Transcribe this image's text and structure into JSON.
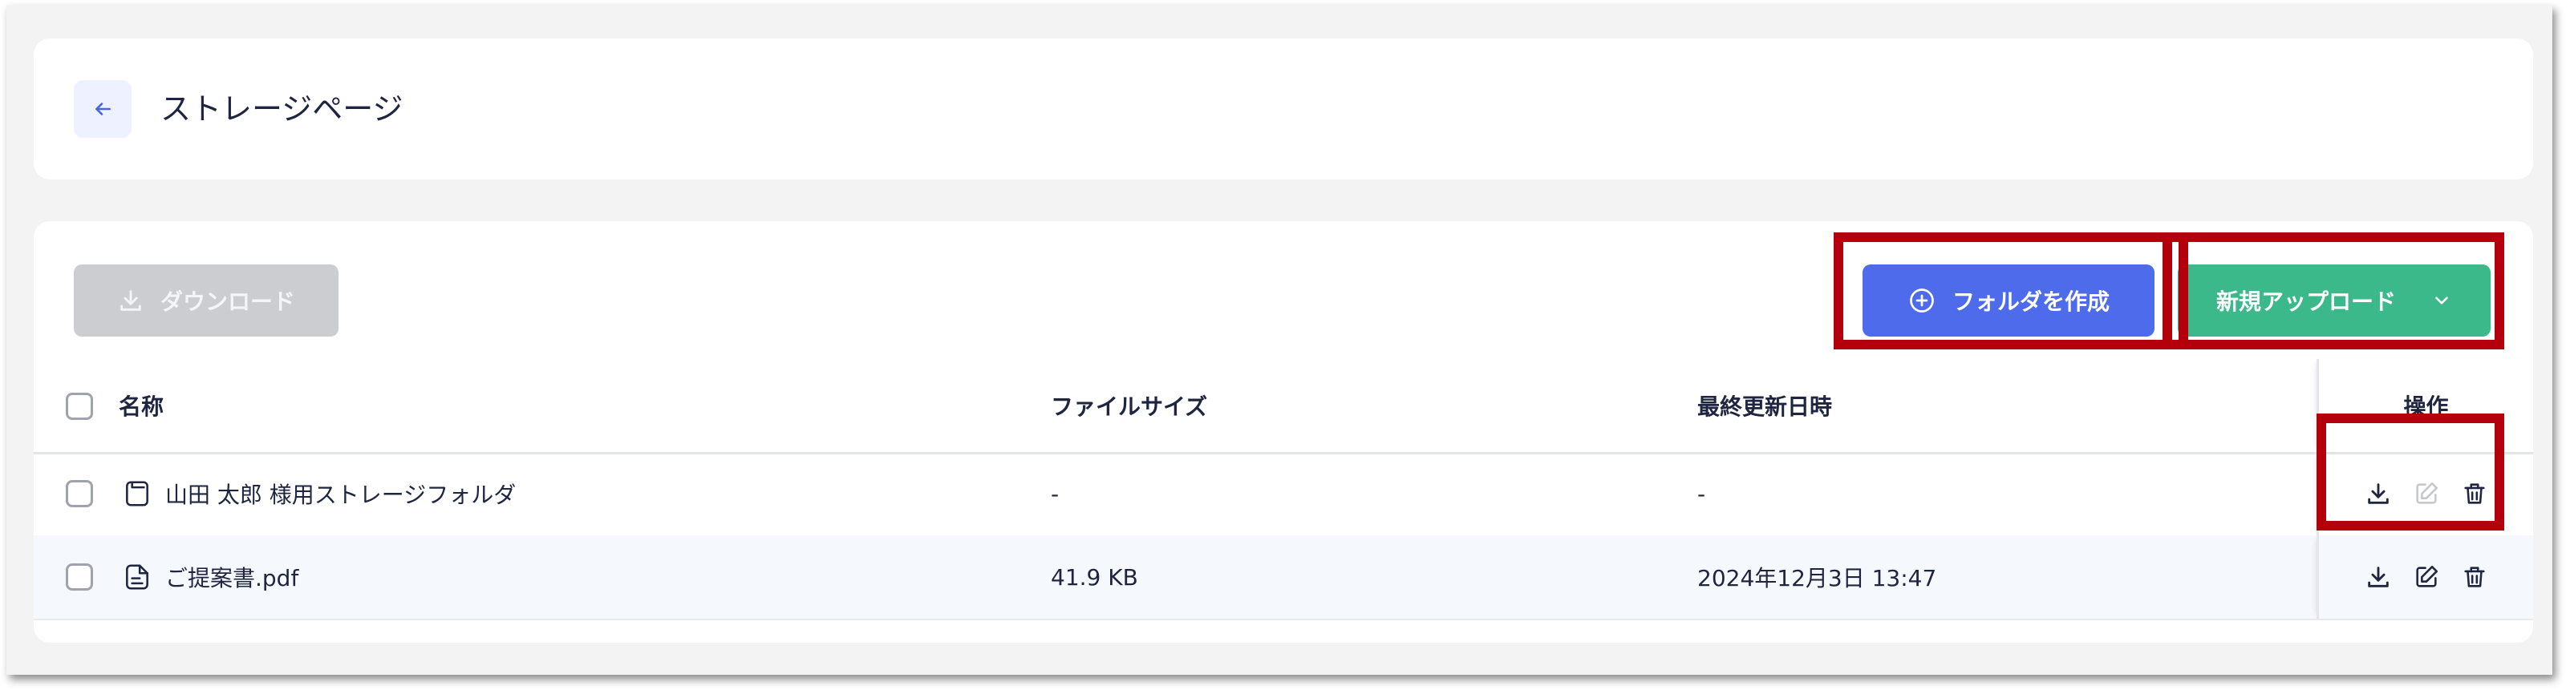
{
  "header": {
    "title": "ストレージページ",
    "back_icon": "arrow-left-icon"
  },
  "toolbar": {
    "download_label": "ダウンロード",
    "create_folder_label": "フォルダを作成",
    "upload_label": "新規アップロード"
  },
  "table": {
    "columns": {
      "name": "名称",
      "size": "ファイルサイズ",
      "updated": "最終更新日時",
      "actions": "操作"
    },
    "rows": [
      {
        "name": "山田 太郎 様用ストレージフォルダ",
        "size": "-",
        "updated": "-",
        "type": "folder"
      },
      {
        "name": "ご提案書.pdf",
        "size": "41.9 KB",
        "updated": "2024年12月3日 13:47",
        "type": "file"
      }
    ]
  },
  "colors": {
    "primary": "#4d6bea",
    "success": "#3bb98a",
    "disabled": "#cbcdd1",
    "highlight": "#b3000c"
  }
}
